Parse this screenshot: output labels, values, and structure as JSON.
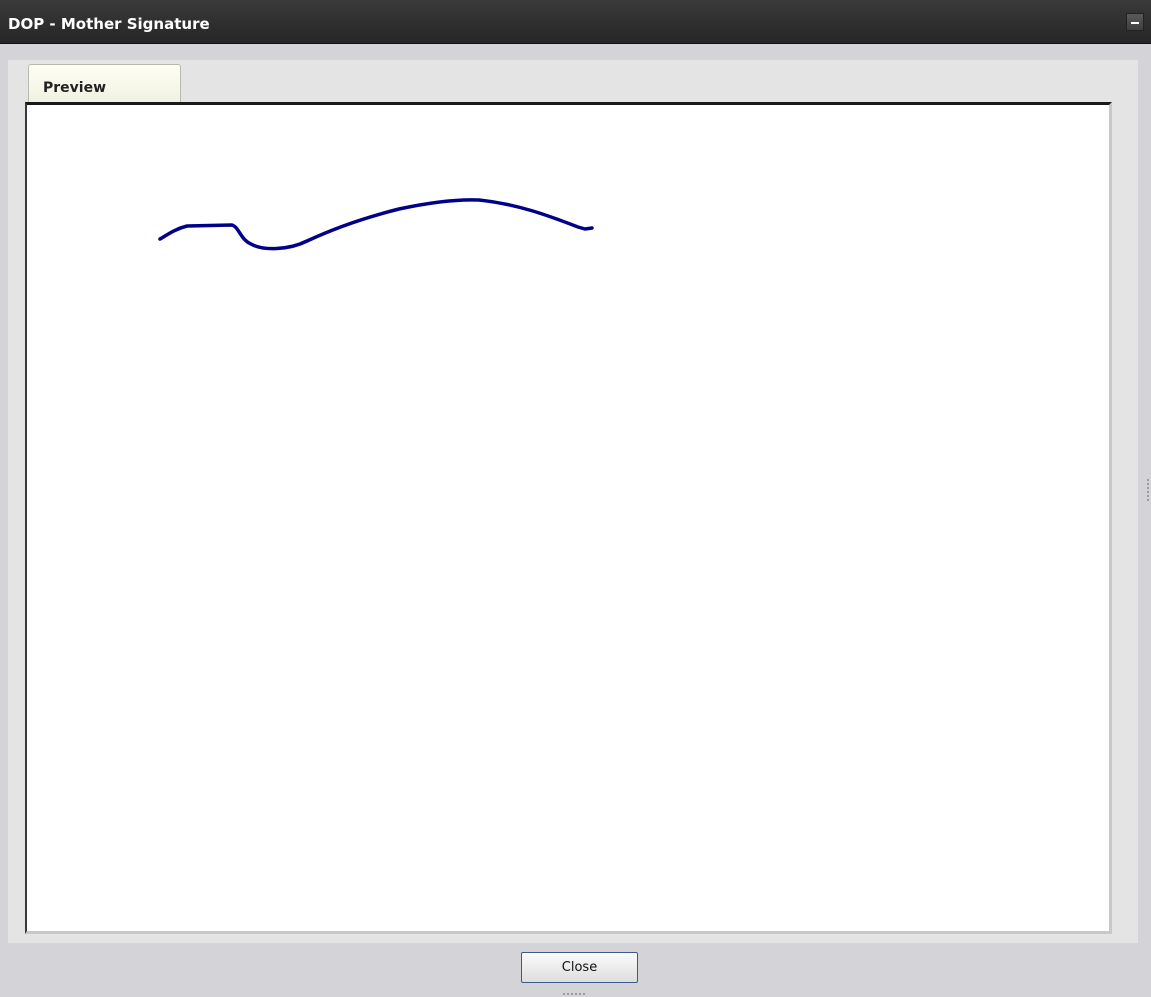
{
  "window": {
    "title": "DOP - Mother Signature"
  },
  "tabs": [
    {
      "label": "Preview",
      "active": true
    }
  ],
  "signature": {
    "stroke_color": "#00008b"
  },
  "footer": {
    "close_label": "Close"
  }
}
